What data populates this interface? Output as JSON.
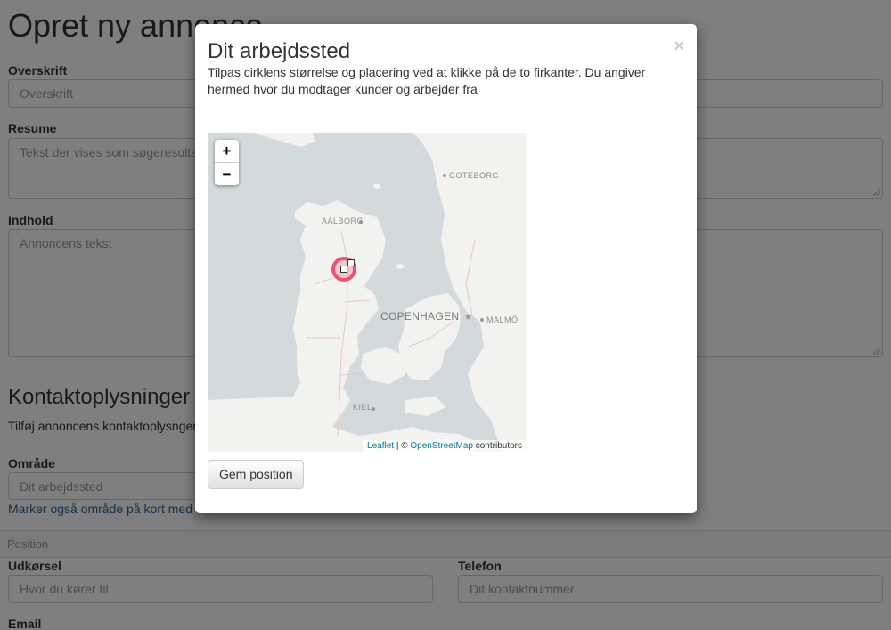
{
  "page": {
    "title": "Opret ny annonce",
    "fields": {
      "overskrift_label": "Overskrift",
      "overskrift_placeholder": "Overskrift",
      "resume_label": "Resume",
      "resume_placeholder": "Tekst der vises som søgeresultat.",
      "indhold_label": "Indhold",
      "indhold_placeholder": "Annoncens tekst"
    },
    "contact": {
      "title": "Kontaktoplysninger",
      "subtitle": "Tilføj annoncens kontaktoplysnger s",
      "omraade_label": "Område",
      "omraade_placeholder": "Dit arbejdssted",
      "map_link": "Marker også område på kort med v",
      "position_bar": "Position",
      "udkoersel_label": "Udkørsel",
      "udkoersel_placeholder": "Hvor du kører til",
      "telefon_label": "Telefon",
      "telefon_placeholder": "Dit kontaktnummer",
      "email_label": "Email"
    }
  },
  "modal": {
    "title": "Dit arbejdssted",
    "close_symbol": "×",
    "description": "Tilpas cirklens størrelse og placering ved at klikke på de to firkanter. Du angiver hermed hvor du modtager kunder og arbejder fra",
    "map": {
      "zoom_in": "+",
      "zoom_out": "−",
      "cities": {
        "goteborg": "GOTEBORG",
        "aalborg": "AALBORG",
        "copenhagen": "COPENHAGEN",
        "malmo": "MALMÖ",
        "kiel": "KIEL"
      },
      "attribution": {
        "leaflet": "Leaflet",
        "separator": "| ©",
        "osm": "OpenStreetMap",
        "contributors": "contributors"
      },
      "colors": {
        "water": "#d4dadc",
        "land": "#f2f2f0",
        "circle": "#e8556f"
      }
    },
    "save_button": "Gem position"
  }
}
